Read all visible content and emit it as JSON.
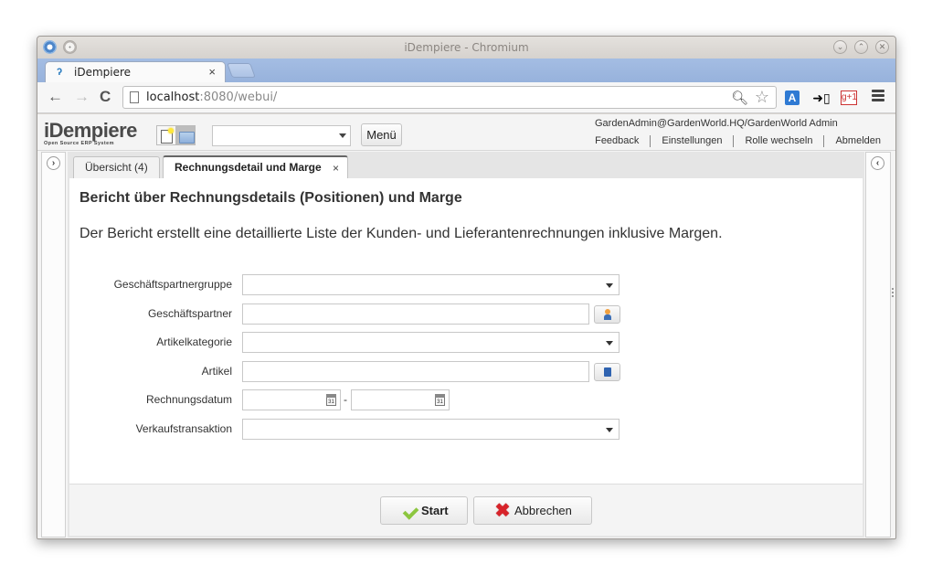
{
  "window": {
    "title": "iDempiere - Chromium",
    "controls": {
      "minimize": "⌄",
      "maximize": "⌃",
      "close": "✕"
    }
  },
  "browser": {
    "tab_title": "iDempiere",
    "tab_close": "×",
    "url_host": "localhost",
    "url_rest": ":8080/webui/",
    "nav": {
      "back": "←",
      "forward": "→",
      "reload": "C"
    },
    "icons": [
      "zoom-icon",
      "bookmark-star-icon",
      "translate-icon",
      "send-to-phone-icon",
      "google-plus-one-icon",
      "menu-icon"
    ],
    "gplus_label": "g+1"
  },
  "app": {
    "logo_main": "iDempiere",
    "logo_sub": "Open Source ERP System",
    "menu_button": "Menü",
    "search_value": "",
    "user": "GardenAdmin@GardenWorld.HQ/GardenWorld Admin",
    "header_links": [
      "Feedback",
      "Einstellungen",
      "Rolle wechseln",
      "Abmelden"
    ],
    "west_toggle": "›",
    "east_toggle": "‹",
    "tabs": [
      {
        "label": "Übersicht (4)",
        "active": false
      },
      {
        "label": "Rechnungsdetail und Marge",
        "active": true,
        "close": "×"
      }
    ]
  },
  "report": {
    "title": "Bericht über Rechnungsdetails (Positionen) und Marge",
    "description": "Der Bericht erstellt eine detaillierte Liste der Kunden- und Lieferantenrechnungen inklusive Margen.",
    "fields": [
      {
        "label": "Geschäftspartnergruppe",
        "type": "combobox",
        "value": ""
      },
      {
        "label": "Geschäftspartner",
        "type": "search",
        "value": "",
        "button_icon": "business-partner-icon"
      },
      {
        "label": "Artikelkategorie",
        "type": "combobox",
        "value": ""
      },
      {
        "label": "Artikel",
        "type": "search",
        "value": "",
        "button_icon": "product-icon"
      },
      {
        "label": "Rechnungsdatum",
        "type": "daterange",
        "from": "",
        "to": "",
        "separator": "-",
        "cal_text": "31"
      },
      {
        "label": "Verkaufstransaktion",
        "type": "combobox",
        "value": ""
      }
    ],
    "buttons": {
      "start": "Start",
      "cancel": "Abbrechen"
    }
  }
}
